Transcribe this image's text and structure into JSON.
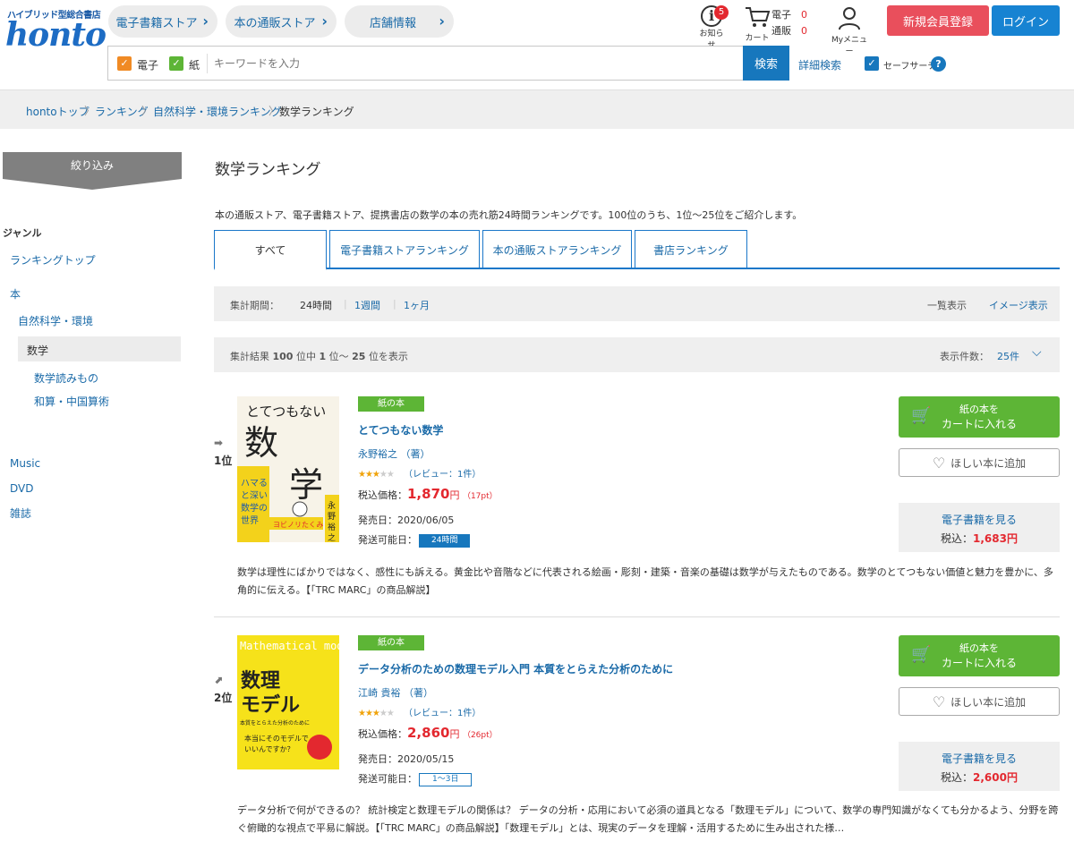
{
  "header": {
    "tagline": "ハイブリッド型総合書店",
    "logo": "honto",
    "nav": [
      "電子書籍ストア",
      "本の通販ストア",
      "店舗情報"
    ],
    "notice_label": "お知らせ",
    "notice_count": "5",
    "cart_label": "カート",
    "cart_ebook_label": "電子",
    "cart_ebook_count": "0",
    "cart_paper_label": "通販",
    "cart_paper_count": "0",
    "mymenu_label": "Myメニュー",
    "register_label": "新規会員登録",
    "login_label": "ログイン"
  },
  "search": {
    "check_ebook": "電子",
    "check_paper": "紙",
    "placeholder": "キーワードを入力",
    "button": "検索",
    "advanced": "詳細検索",
    "safe_search": "セーフサーチ"
  },
  "breadcrumb": [
    "hontoトップ",
    "ランキング",
    "自然科学・環境ランキング",
    "数学ランキング"
  ],
  "sidebar": {
    "filter_label": "絞り込み",
    "genre_title": "ジャンル",
    "ranking_top": "ランキングトップ",
    "book": "本",
    "natural_science": "自然科学・環境",
    "math": "数学",
    "math_reading": "数学読みもの",
    "wasan": "和算・中国算術",
    "music": "Music",
    "dvd": "DVD",
    "magazine": "雑誌"
  },
  "main": {
    "title": "数学ランキング",
    "description": "本の通販ストア、電子書籍ストア、提携書店の数学の本の売れ筋24時間ランキングです。100位のうち、1位～25位をご紹介します。",
    "tabs": [
      "すべて",
      "電子書籍ストアランキング",
      "本の通販ストアランキング",
      "書店ランキング"
    ],
    "period_label": "集計期間：",
    "periods": [
      "24時間",
      "1週間",
      "1ヶ月"
    ],
    "view_list": "一覧表示",
    "view_image": "イメージ表示",
    "result_text_prefix": "集計結果",
    "result_total": "100",
    "result_mid1": "位中",
    "result_from": "1",
    "result_mid2": "位～",
    "result_to": "25",
    "result_suffix": "位を表示",
    "per_page_label": "表示件数：",
    "per_page_value": "25件"
  },
  "items": [
    {
      "rank": "1位",
      "tag": "紙の本",
      "title": "とてつもない数学",
      "author": "永野裕之 （著）",
      "rating": 3,
      "review": "（レビュー：1件）",
      "price_label": "税込価格：",
      "price": "1,870",
      "price_unit": "円",
      "points": "（17pt）",
      "date": "発売日：2020/06/05",
      "ship_label": "発送可能日：",
      "ship": "24時間",
      "cart_line1": "紙の本を",
      "cart_line2": "カートに入れる",
      "wish": "ほしい本に追加",
      "ebook_label": "電子書籍を見る",
      "ebook_price_label": "税込：",
      "ebook_price": "1,683円",
      "desc": "数学は理性にばかりではなく、感性にも訴える。黄金比や音階などに代表される絵画・彫刻・建築・音楽の基礎は数学が与えたものである。数学のとてつもない価値と魅力を豊かに、多角的に伝える。【「TRC MARC」の商品解説】",
      "cover_title": "とてつもない",
      "cover_big": "数学",
      "cover_author": "永野裕之"
    },
    {
      "rank": "2位",
      "tag": "紙の本",
      "title": "データ分析のための数理モデル入門 本質をとらえた分析のために",
      "author": "江崎 貴裕 （著）",
      "rating": 3,
      "review": "（レビュー：1件）",
      "price_label": "税込価格：",
      "price": "2,860",
      "price_unit": "円",
      "points": "（26pt）",
      "date": "発売日：2020/05/15",
      "ship_label": "発送可能日：",
      "ship": "1～3日",
      "cart_line1": "紙の本を",
      "cart_line2": "カートに入れる",
      "wish": "ほしい本に追加",
      "ebook_label": "電子書籍を見る",
      "ebook_price_label": "税込：",
      "ebook_price": "2,600円",
      "desc": "データ分析で何ができるの？ 統計検定と数理モデルの関係は？ データの分析・応用において必須の道具となる「数理モデル」について、数学の専門知識がなくても分かるよう、分野を跨ぐ俯瞰的な視点で平易に解説。【「TRC MARC」の商品解説】「数理モデル」とは、現実のデータを理解・活用するために生み出された様…",
      "cover_title": "Mathematical model",
      "cover_big": "数理モデル",
      "cover_sub": "データ分析のための",
      "cover_author": "江崎貴裕"
    }
  ],
  "colors": {
    "accent_blue": "#1777bd",
    "link_blue": "#1a6aa8",
    "green": "#5db536",
    "red": "#e3282f",
    "pink": "#e94f5c"
  }
}
